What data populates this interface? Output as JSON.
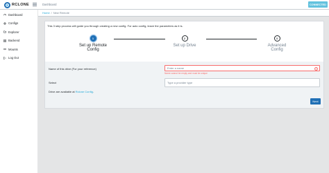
{
  "app": {
    "logo_text": "RCLONE",
    "nav_link": "Dashboard",
    "status_button": "CONNECTED"
  },
  "sidebar": {
    "items": [
      {
        "label": "Dashboard",
        "icon": "speedometer-icon"
      },
      {
        "label": "Configs",
        "icon": "gear-icon"
      },
      {
        "label": "Explorer",
        "icon": "folder-icon"
      },
      {
        "label": "Backend",
        "icon": "server-icon"
      },
      {
        "label": "Mounts",
        "icon": "drive-icon"
      },
      {
        "label": "Log Out",
        "icon": "logout-icon"
      }
    ]
  },
  "breadcrumb": {
    "home": "Home",
    "separator": "/",
    "current": "New Remote"
  },
  "wizard": {
    "intro": "This 3 step process will guide you through creating a new config. For auto config, leave the parameters as it is.",
    "steps": [
      {
        "number": "1",
        "label_line1": "Set up Remote",
        "label_line2": "Config",
        "active": true
      },
      {
        "number": "2",
        "label_line1": "Set up Drive",
        "label_line2": "",
        "active": false
      },
      {
        "number": "3",
        "label_line1": "Advanced",
        "label_line2": "Config",
        "active": false
      }
    ]
  },
  "form": {
    "name_label": "Name of this drive (For your reference)",
    "name_placeholder": "Enter a name",
    "name_error": "Name cannot be empty and must be unique",
    "select_label": "Select",
    "provider_placeholder": "Type a provider type",
    "drives_prefix": "Drive are available at",
    "drives_link": "Rclone Config",
    "drives_suffix": ".",
    "next_label": "Next"
  },
  "colors": {
    "primary": "#1f6fb5",
    "accent": "#63c2de",
    "link": "#20a8d8",
    "error": "#f86c6b"
  }
}
